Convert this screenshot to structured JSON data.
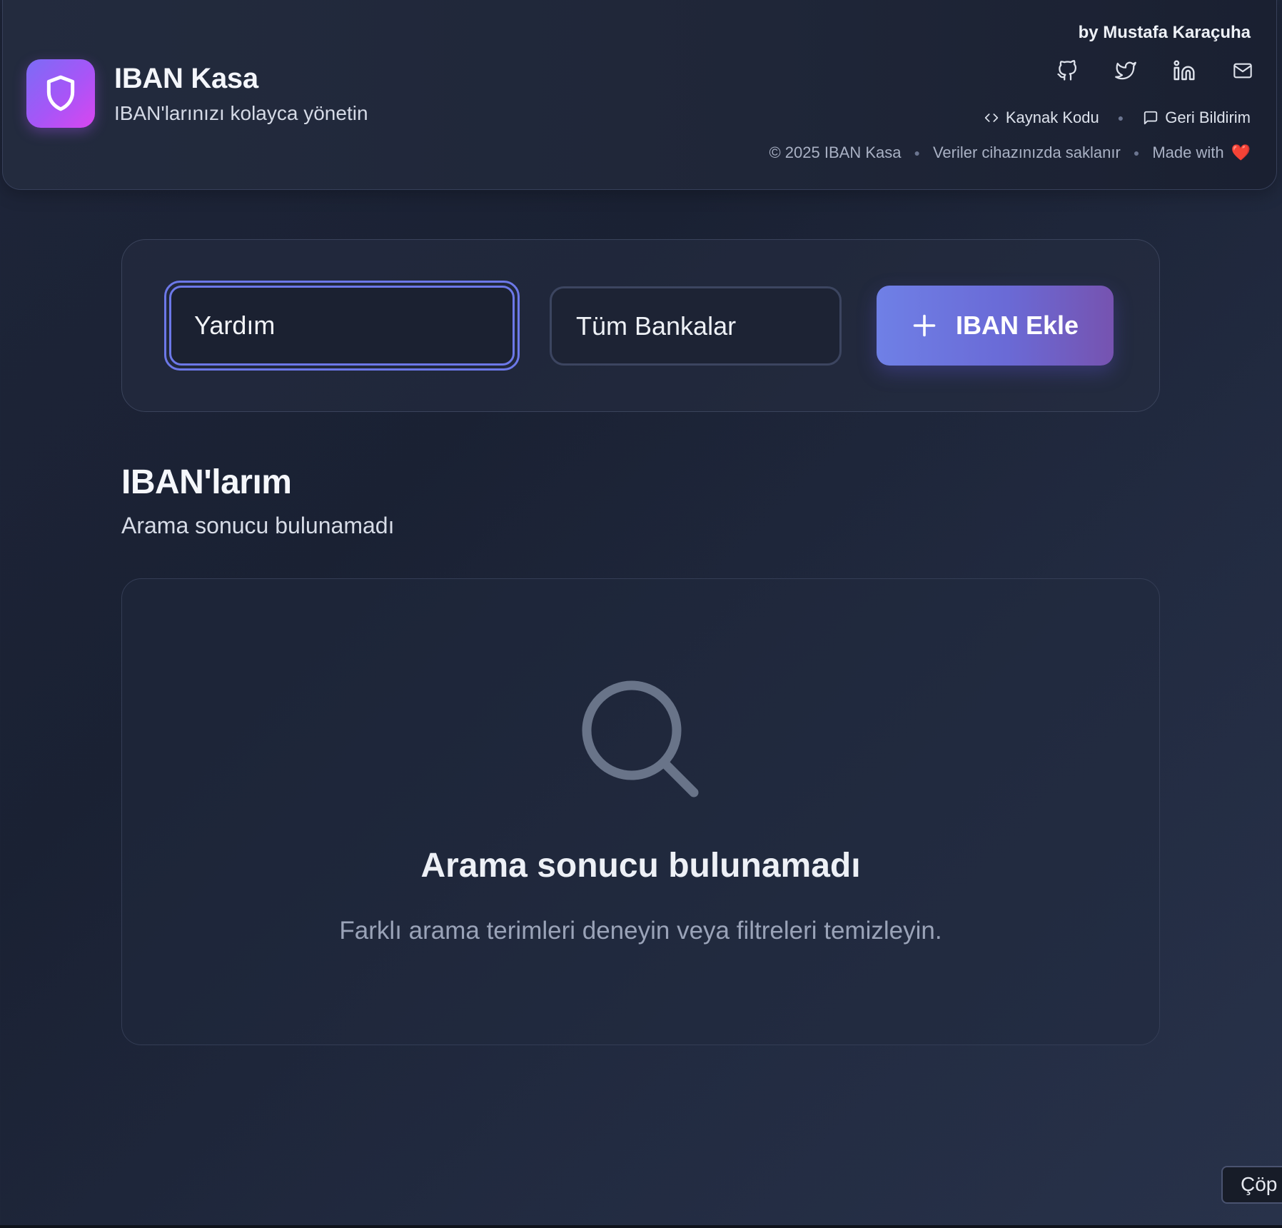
{
  "header": {
    "title": "IBAN Kasa",
    "subtitle": "IBAN'larınızı kolayca yönetin",
    "author": "by Mustafa Karaçuha",
    "social_icons": [
      "github-icon",
      "twitter-icon",
      "linkedin-icon",
      "mail-icon"
    ],
    "links": {
      "source_code": "Kaynak Kodu",
      "feedback": "Geri Bildirim"
    },
    "footer": {
      "copyright": "© 2025 IBAN Kasa",
      "storage_note": "Veriler cihazınızda saklanır",
      "made_with": "Made with",
      "heart": "❤️"
    }
  },
  "filters": {
    "search_value": "Yardım",
    "bank_select_value": "Tüm Bankalar",
    "add_button_label": "IBAN Ekle"
  },
  "section": {
    "title": "IBAN'larım",
    "subtitle": "Arama sonucu bulunamadı"
  },
  "empty_state": {
    "title": "Arama sonucu bulunamadı",
    "description": "Farklı arama terimleri deneyin veya filtreleri temizleyin."
  },
  "trash_button": {
    "label": "Çöp"
  },
  "colors": {
    "accent": "#6c78e8",
    "brand_gradient_start": "#7b6cf6",
    "brand_gradient_end": "#d946ef",
    "button_gradient_start": "#6f80e6",
    "button_gradient_end": "#7653b0",
    "background": "#1e2539"
  }
}
